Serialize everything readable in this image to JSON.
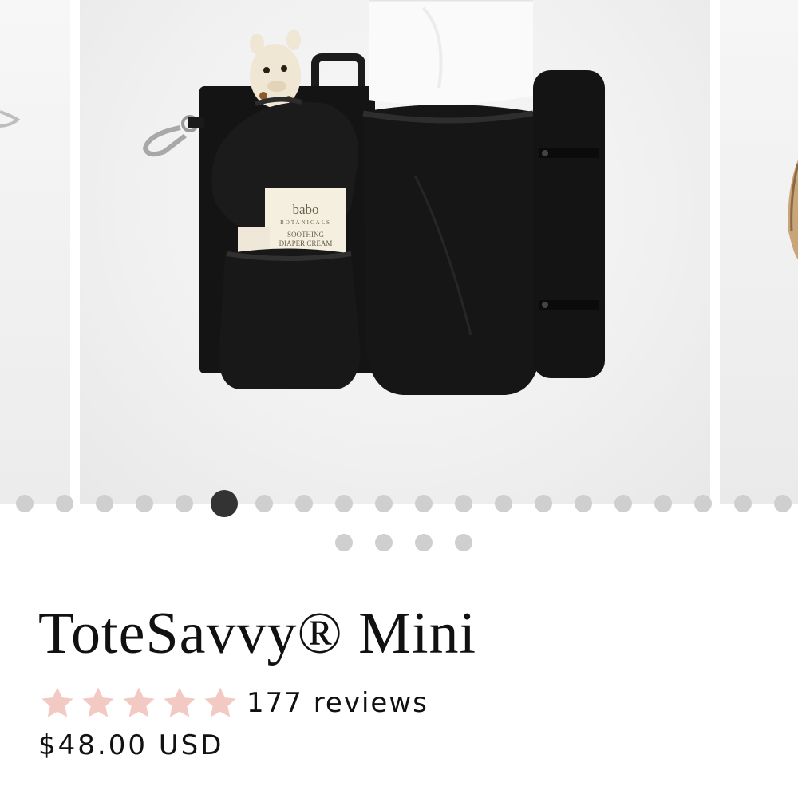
{
  "carousel": {
    "slide_count": 24,
    "active_index": 5,
    "image": {
      "baby_cream_brand": "babo",
      "baby_cream_sub": "BOTANICALS",
      "baby_cream_line1": "SOOTHING",
      "baby_cream_line2": "DIAPER CREAM"
    }
  },
  "product": {
    "title": "ToteSavvy® Mini",
    "rating_stars": 5,
    "reviews_label": "177 reviews",
    "price": "$48.00 USD"
  },
  "colors": {
    "star": "#f3c9c4",
    "active_dot": "#333333",
    "inactive_dot": "#cfcfcf",
    "text": "#111111"
  }
}
